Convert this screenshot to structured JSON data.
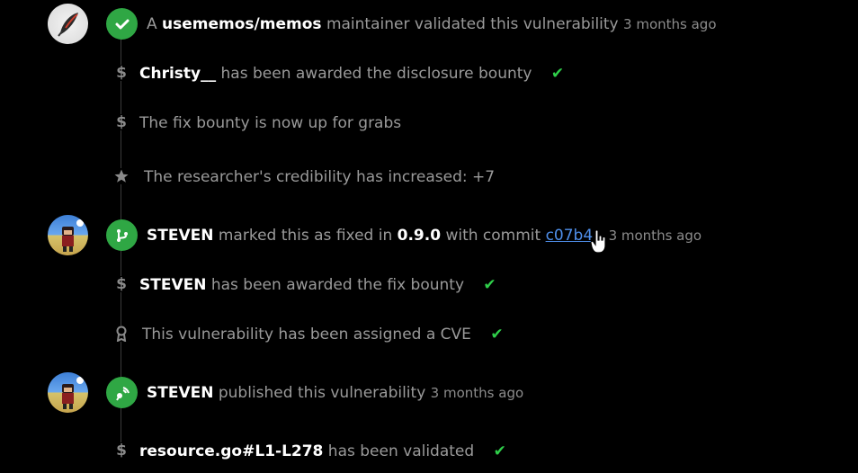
{
  "events": {
    "validated": {
      "prefix": "A",
      "repo": "usememos/memos",
      "role": "maintainer",
      "action": "validated this vulnerability",
      "time": "3 months ago"
    },
    "disclosure_bounty": {
      "user": "Christy__",
      "text": "has been awarded the disclosure bounty"
    },
    "fix_bounty_open": {
      "text": "The fix bounty is now up for grabs"
    },
    "credibility": {
      "text": "The researcher's credibility has increased: +7"
    },
    "marked_fixed": {
      "user": "STEVEN",
      "text1": "marked this as fixed in",
      "version": "0.9.0",
      "text2": "with commit",
      "commit": "c07b4",
      "time": "3 months ago"
    },
    "fix_bounty_awarded": {
      "user": "STEVEN",
      "text": "has been awarded the fix bounty"
    },
    "cve": {
      "text": "This vulnerability has been assigned a CVE"
    },
    "published": {
      "user": "STEVEN",
      "text": "published this vulnerability",
      "time": "3 months ago"
    },
    "file_validated": {
      "file": "resource.go#L1-L278",
      "text": "has been validated"
    }
  },
  "icons": {
    "dollar": "$",
    "check": "✔"
  },
  "colors": {
    "green": "#2fa744",
    "check_green": "#2fcf4a",
    "link": "#4f8fea"
  }
}
